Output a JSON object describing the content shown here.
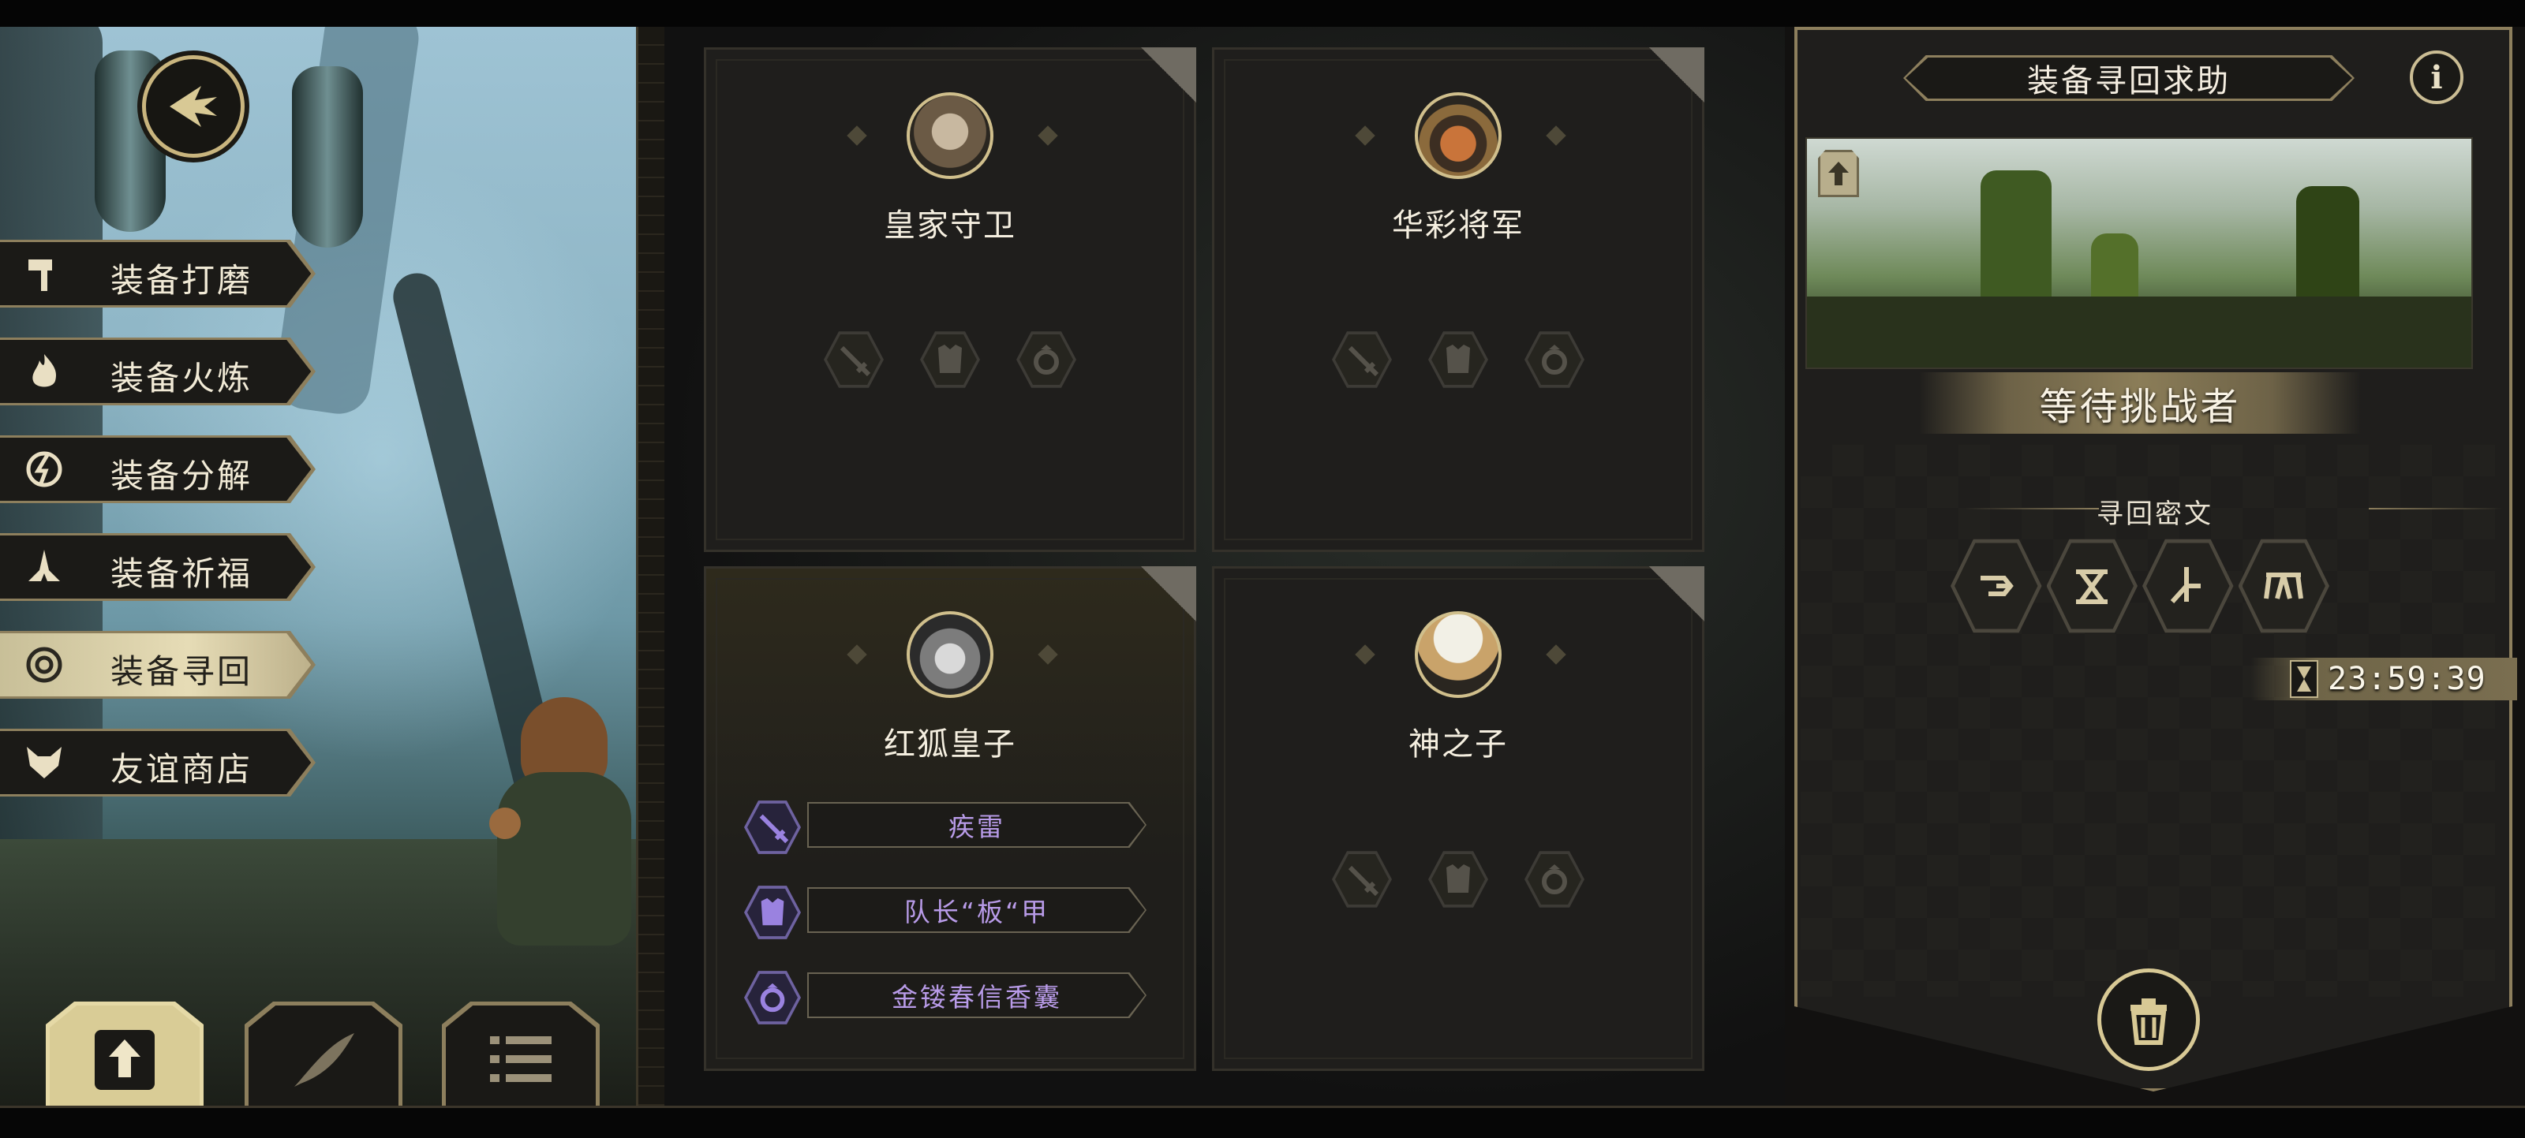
{
  "sidebar": {
    "items": [
      {
        "label": "装备打磨",
        "icon": "hammer-icon",
        "active": false
      },
      {
        "label": "装备火炼",
        "icon": "flame-icon",
        "active": false
      },
      {
        "label": "装备分解",
        "icon": "disassemble-icon",
        "active": false
      },
      {
        "label": "装备祈福",
        "icon": "praying-hands-icon",
        "active": false
      },
      {
        "label": "装备寻回",
        "icon": "target-icon",
        "active": true
      },
      {
        "label": "友谊商店",
        "icon": "fox-icon",
        "active": false
      }
    ],
    "back_icon": "back-arrow-icon"
  },
  "toolbar": {
    "buttons": [
      {
        "icon": "upload-icon",
        "active": true
      },
      {
        "icon": "quill-icon",
        "active": false
      },
      {
        "icon": "list-icon",
        "active": false
      }
    ]
  },
  "heroes": [
    {
      "name": "皇家守卫",
      "slots": [
        "sword-icon",
        "armor-icon",
        "ring-icon"
      ],
      "equipment": []
    },
    {
      "name": "华彩将军",
      "slots": [
        "sword-icon",
        "armor-icon",
        "ring-icon"
      ],
      "equipment": []
    },
    {
      "name": "红狐皇子",
      "equipment": [
        {
          "name": "疾雷",
          "icon": "sword-icon"
        },
        {
          "name": "队长“板“甲",
          "icon": "armor-icon"
        },
        {
          "name": "金镂春信香囊",
          "icon": "ring-icon"
        }
      ]
    },
    {
      "name": "神之子",
      "slots": [
        "sword-icon",
        "armor-icon",
        "ring-icon"
      ],
      "equipment": []
    }
  ],
  "panel": {
    "title": "装备寻回求助",
    "info_label": "i",
    "status": "等待挑战者",
    "cipher_label": "寻回密文",
    "ciphers": [
      "cipher-rune-1-icon",
      "cipher-rune-2-icon",
      "cipher-rune-3-icon",
      "cipher-rune-4-icon"
    ],
    "timer": "23:59:39"
  },
  "colors": {
    "gold": "#c9b57e",
    "epic_purple": "#b89be8",
    "panel_bg": "#1f1e1c"
  }
}
